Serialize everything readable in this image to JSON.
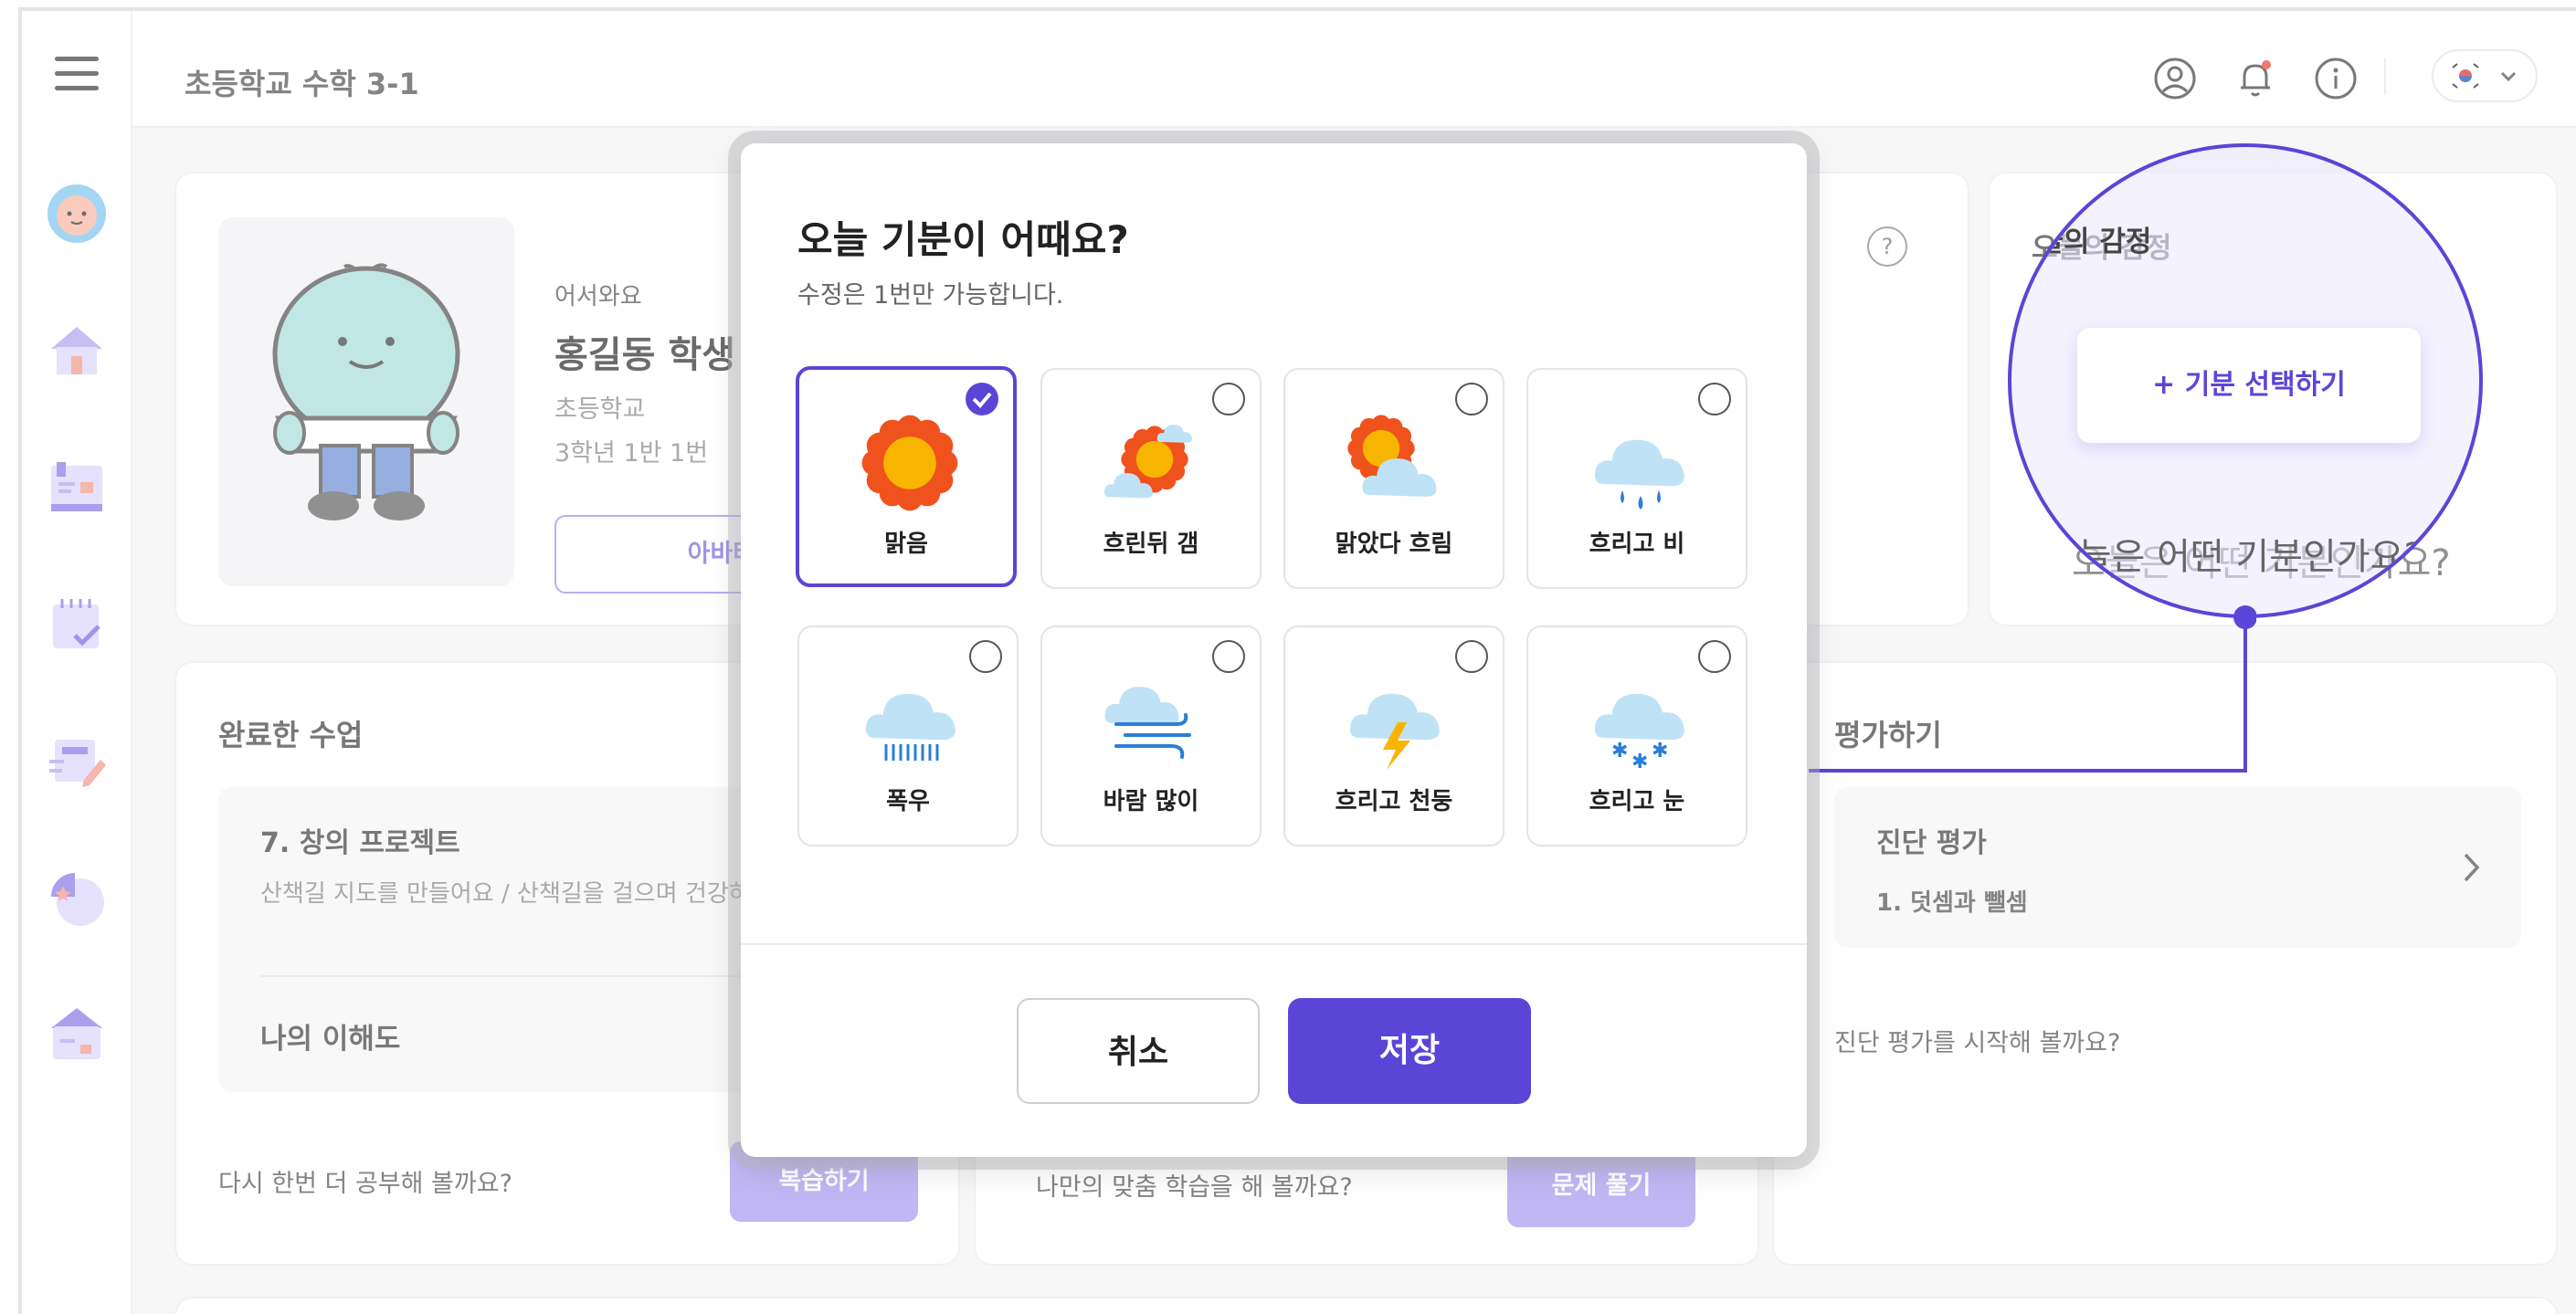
{
  "header": {
    "title": "초등학교 수학 3-1"
  },
  "welcome": {
    "greeting": "어서와요",
    "name": "홍길동 학생",
    "school": "초등학교",
    "class_info": "3학년 1반 1번",
    "avatar_button": "아바타 꾸"
  },
  "emotion_card": {
    "title": "오늘의 감정",
    "select_button": "+ 기분 선택하기",
    "prompt": "오늘은 어떤 기분인가요?",
    "help": "?"
  },
  "completed": {
    "title": "완료한 수업",
    "lesson_title": "7. 창의 프로젝트",
    "lesson_desc": "산책길 지도를 만들어요 / 산책길을 걸으며 건강하",
    "understanding": "나의 이해도",
    "footer_text": "다시 한번 더 공부해 볼까요?",
    "review_button": "복습하기"
  },
  "custom": {
    "footer_text": "나만의 맞춤 학습을 해 볼까요?",
    "solve_button": "문제 풀기"
  },
  "evaluation": {
    "title": "평가하기",
    "item_title": "진단 평가",
    "item_sub": "1. 덧셈과 뺄셈",
    "footer_text": "진단 평가를 시작해 볼까요?"
  },
  "modal": {
    "title": "오늘 기분이 어때요?",
    "subtitle": "수정은 1번만 가능합니다.",
    "options": [
      {
        "label": "맑음",
        "icon": "sunny-icon",
        "selected": true
      },
      {
        "label": "흐린뒤 갬",
        "icon": "cloudy-then-clear-icon",
        "selected": false
      },
      {
        "label": "맑았다 흐림",
        "icon": "sun-behind-cloud-icon",
        "selected": false
      },
      {
        "label": "흐리고 비",
        "icon": "rain-cloud-icon",
        "selected": false
      },
      {
        "label": "폭우",
        "icon": "heavy-rain-icon",
        "selected": false
      },
      {
        "label": "바람 많이",
        "icon": "windy-icon",
        "selected": false
      },
      {
        "label": "흐리고 천둥",
        "icon": "thunder-cloud-icon",
        "selected": false
      },
      {
        "label": "흐리고 눈",
        "icon": "snow-cloud-icon",
        "selected": false
      }
    ],
    "cancel": "취소",
    "save": "저장"
  },
  "colors": {
    "accent": "#5b45d6",
    "accent_light": "#a99cf0",
    "sun": "#f7b500",
    "sun_petal": "#f0521e",
    "cloud": "#bfe2f7"
  }
}
